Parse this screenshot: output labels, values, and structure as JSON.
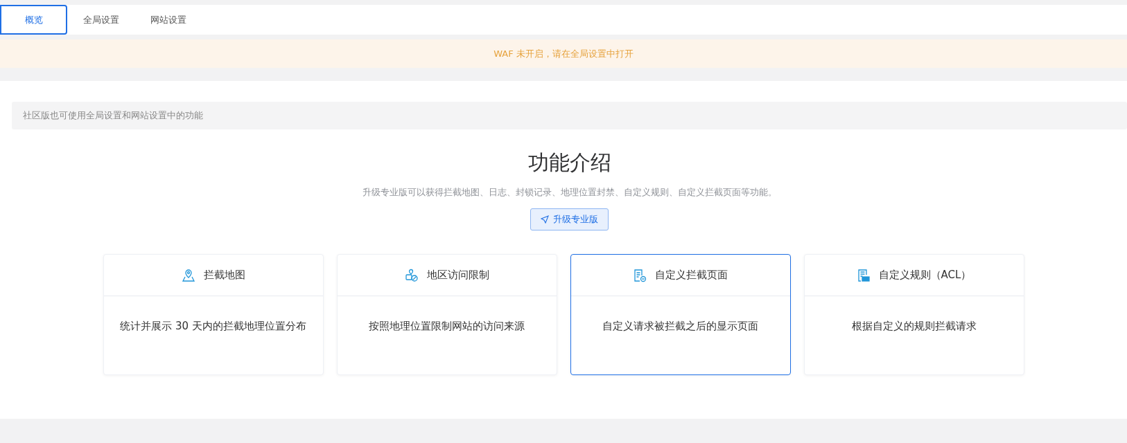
{
  "tabs": [
    {
      "label": "概览",
      "selected": true
    },
    {
      "label": "全局设置",
      "selected": false
    },
    {
      "label": "网站设置",
      "selected": false
    }
  ],
  "warning": "WAF 未开启，请在全局设置中打开",
  "notice": "社区版也可使用全局设置和网站设置中的功能",
  "intro": {
    "title": "功能介绍",
    "subtitle": "升级专业版可以获得拦截地图、日志、封锁记录、地理位置封禁、自定义规则、自定义拦截页面等功能。",
    "button": "升级专业版"
  },
  "features": [
    {
      "kind": "map",
      "title": "拦截地图",
      "description": "统计并展示 30 天内的拦截地理位置分布",
      "selected": false
    },
    {
      "kind": "region",
      "title": "地区访问限制",
      "description": "按照地理位置限制网站的访问来源",
      "selected": false
    },
    {
      "kind": "page",
      "title": "自定义拦截页面",
      "description": "自定义请求被拦截之后的显示页面",
      "selected": true
    },
    {
      "kind": "rule",
      "title": "自定义规则（ACL）",
      "description": "根据自定义的规则拦截请求",
      "selected": false
    }
  ]
}
